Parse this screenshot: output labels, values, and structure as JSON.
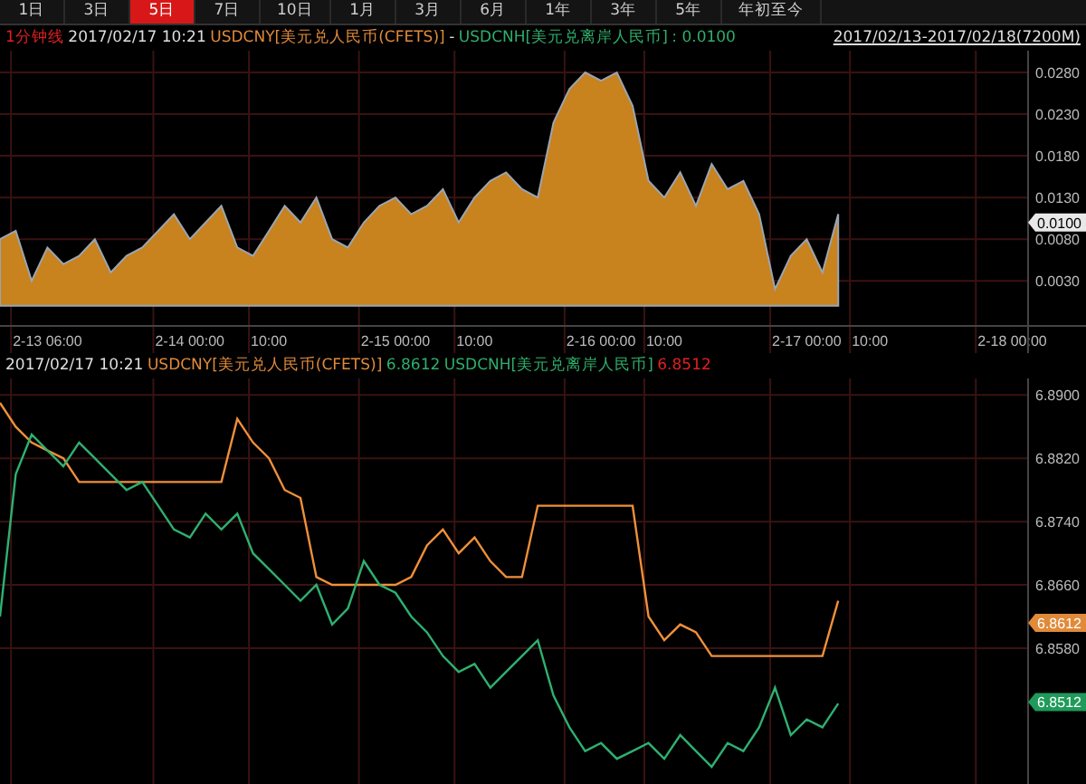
{
  "tabs": [
    {
      "label": "1日",
      "selected": false
    },
    {
      "label": "3日",
      "selected": false
    },
    {
      "label": "5日",
      "selected": true
    },
    {
      "label": "7日",
      "selected": false
    },
    {
      "label": "10日",
      "selected": false
    },
    {
      "label": "1月",
      "selected": false
    },
    {
      "label": "3月",
      "selected": false
    },
    {
      "label": "6月",
      "selected": false
    },
    {
      "label": "1年",
      "selected": false
    },
    {
      "label": "3年",
      "selected": false
    },
    {
      "label": "5年",
      "selected": false
    },
    {
      "label": "年初至今",
      "selected": false
    }
  ],
  "spread_panel": {
    "legend": [
      {
        "text": "1分钟线",
        "color": "#e02020"
      },
      {
        "text": "2017/02/17 10:21",
        "color": "#dddddd"
      },
      {
        "text": "USDCNY[美元兑人民币(CFETS)]",
        "color": "#e08a3a"
      },
      {
        "text": "-",
        "color": "#dddddd"
      },
      {
        "text": "USDCNH[美元兑离岸人民币]",
        "color": "#2fae6a"
      },
      {
        "text": ": 0.0100",
        "color": "#2fae6a"
      }
    ],
    "date_range": "2017/02/13-2017/02/18(7200M)",
    "value_tag": {
      "text": "0.0100"
    },
    "chart_data": {
      "type": "area",
      "grid": true,
      "categories": [
        null,
        null,
        null,
        "2-13 06:00",
        null,
        null,
        null,
        null,
        null,
        null,
        null,
        null,
        "2-14 00:00",
        null,
        null,
        null,
        null,
        "10:00",
        null,
        null,
        null,
        null,
        null,
        null,
        null,
        "2-15 00:00",
        null,
        null,
        null,
        null,
        "10:00",
        null,
        null,
        null,
        null,
        null,
        null,
        null,
        "2-16 00:00",
        null,
        null,
        null,
        "10:00",
        null,
        null,
        null,
        null,
        null,
        null,
        null,
        null,
        "2-17 00:00",
        null,
        null,
        null,
        "10:00",
        null,
        null,
        null,
        null,
        null,
        null,
        null,
        null,
        "2-18 00:00"
      ],
      "ylim": [
        -0.0024,
        0.0306
      ],
      "series": [
        {
          "color": "#c8821e",
          "values": [
            0.008,
            0.009,
            0.003,
            0.007,
            0.005,
            0.006,
            0.008,
            0.004,
            0.006,
            0.007,
            0.009,
            0.011,
            0.008,
            0.01,
            0.012,
            0.007,
            0.006,
            0.009,
            0.012,
            0.01,
            0.013,
            0.008,
            0.007,
            0.01,
            0.012,
            0.013,
            0.011,
            0.012,
            0.014,
            0.01,
            0.013,
            0.015,
            0.016,
            0.014,
            0.013,
            0.022,
            0.026,
            0.028,
            0.027,
            0.028,
            0.024,
            0.015,
            0.013,
            0.016,
            0.012,
            0.017,
            0.014,
            0.015,
            0.011,
            0.002,
            0.006,
            0.008,
            0.004,
            0.011,
            null,
            null,
            null,
            null,
            null,
            null,
            null,
            null,
            null,
            null,
            null
          ]
        }
      ],
      "yticks": [
        {
          "value": 0.003,
          "label": "0.0030"
        },
        {
          "value": 0.008,
          "label": "0.0080"
        },
        {
          "value": 0.013,
          "label": "0.0130"
        },
        {
          "value": 0.018,
          "label": "0.0180"
        },
        {
          "value": 0.023,
          "label": "0.0230"
        },
        {
          "value": 0.028,
          "label": "0.0280"
        }
      ]
    }
  },
  "price_panel": {
    "legend": [
      {
        "text": "2017/02/17 10:21",
        "color": "#dddddd"
      },
      {
        "text": "USDCNY[美元兑人民币(CFETS)]",
        "color": "#e08a3a"
      },
      {
        "text": "6.8612",
        "color": "#2fae6a"
      },
      {
        "text": "USDCNH[美元兑离岸人民币]",
        "color": "#2fae6a"
      },
      {
        "text": "6.8512",
        "color": "#e02020"
      }
    ],
    "value_tags": [
      {
        "text": "6.8612",
        "color": "#e08a3a"
      },
      {
        "text": "6.8512",
        "color": "#1f9a5a"
      }
    ],
    "chart_data": {
      "type": "line",
      "grid": true,
      "ylim": [
        6.8406,
        6.8921
      ],
      "series": [
        {
          "color": "#f0903a",
          "values": [
            6.889,
            6.886,
            6.884,
            6.883,
            6.882,
            6.879,
            6.879,
            6.879,
            6.879,
            6.879,
            6.879,
            6.879,
            6.879,
            6.879,
            6.879,
            6.887,
            6.884,
            6.882,
            6.878,
            6.877,
            6.867,
            6.866,
            6.866,
            6.866,
            6.866,
            6.866,
            6.867,
            6.871,
            6.873,
            6.87,
            6.872,
            6.869,
            6.867,
            6.867,
            6.876,
            6.876,
            6.876,
            6.876,
            6.876,
            6.876,
            6.876,
            6.862,
            6.859,
            6.861,
            6.86,
            6.857,
            6.857,
            6.857,
            6.857,
            6.857,
            6.857,
            6.857,
            6.857,
            6.864
          ]
        },
        {
          "color": "#2fb070",
          "values": [
            6.862,
            6.88,
            6.885,
            6.883,
            6.881,
            6.884,
            6.882,
            6.88,
            6.878,
            6.879,
            6.876,
            6.873,
            6.872,
            6.875,
            6.873,
            6.875,
            6.87,
            6.868,
            6.866,
            6.864,
            6.866,
            6.861,
            6.863,
            6.869,
            6.866,
            6.865,
            6.862,
            6.86,
            6.857,
            6.855,
            6.856,
            6.853,
            6.855,
            6.857,
            6.859,
            6.852,
            6.848,
            6.845,
            6.846,
            6.844,
            6.845,
            6.846,
            6.844,
            6.847,
            6.845,
            6.843,
            6.846,
            6.845,
            6.848,
            6.853,
            6.847,
            6.849,
            6.848,
            6.851
          ]
        }
      ],
      "yticks": [
        {
          "value": 6.858,
          "label": "6.8580"
        },
        {
          "value": 6.866,
          "label": "6.8660"
        },
        {
          "value": 6.874,
          "label": "6.8740"
        },
        {
          "value": 6.882,
          "label": "6.8820"
        },
        {
          "value": 6.89,
          "label": "6.8900"
        }
      ]
    }
  }
}
